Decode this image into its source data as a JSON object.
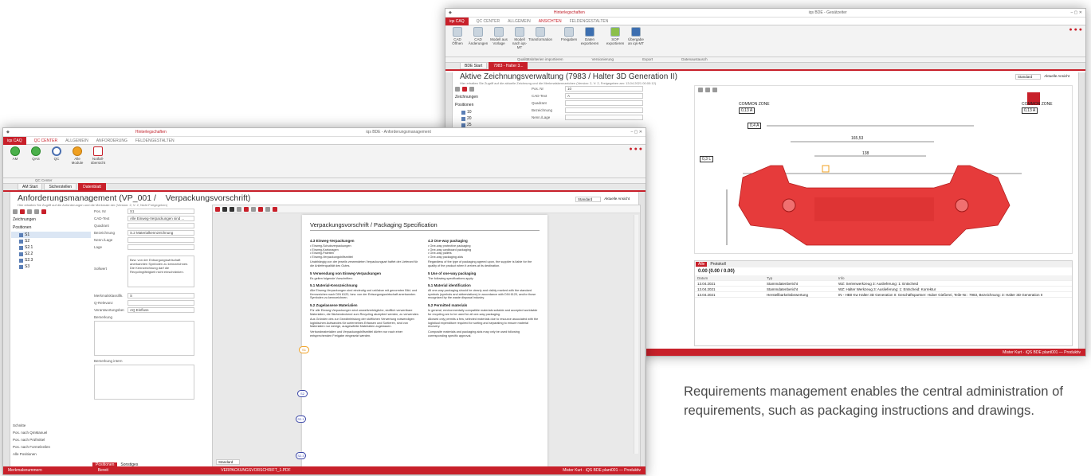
{
  "caption": "Requirements management enables the central administration of requirements, such as packaging instructions and drawings.",
  "back_window": {
    "title": "iqs BDE - Gesätzeiter",
    "context_tab": "Hinterlegschaften",
    "ribbon_tabs": [
      "iqs CAQ",
      "QC CENTER",
      "ALLGEMEIN",
      "ANSICHTEN",
      "FELDENGESTALTEN"
    ],
    "ribbon_buttons": [
      "CAD Öffnen",
      "CAD Änderungen",
      "Modell aus Vorlage",
      "Modell nach iqs-MT",
      "Transformation",
      "Freigaben",
      "Daten exportieren",
      "SOP exportieren",
      "Übergabe an iqs-MT"
    ],
    "ribbon_groups": [
      "Qualitätskriterien importieren",
      "Versionierung",
      "Export",
      "Datenaustausch"
    ],
    "doc_tabs": [
      "BDE Start",
      "7983 - Halter 3..."
    ],
    "heading": "Aktive Zeichnungsverwaltung (7983 / Halter 3D Generation II)",
    "subheading": "Hier erhalten Sie Zugriff auf die aktuelle Zeichnung und die Merkmalskennzeichen (Version: 2, V: 2, Freigegeben am: 13.04.2021 00:00:12)",
    "view_select": "Standard",
    "view_button": "Aktuelle Ansicht",
    "tree_labels": [
      "Zeichnungen",
      "Positionen"
    ],
    "tree_items": [
      "10",
      "20",
      "25"
    ],
    "fields": [
      {
        "label": "Pos. Nr",
        "value": "10"
      },
      {
        "label": "CAD-Text",
        "value": "A"
      },
      {
        "label": "Quadrant",
        "value": ""
      },
      {
        "label": "Bezeichnung",
        "value": ""
      },
      {
        "label": "Nenn./Lage",
        "value": ""
      }
    ],
    "dimensions": [
      "COMMON ZONE",
      "0,13 A",
      "COMMON ZONE",
      "0,13 A",
      "0,4 A",
      "165,53",
      "138",
      "0,3 L"
    ],
    "subpanel_tabs": [
      "Alle",
      "Protokoll"
    ],
    "subpanel_value": "0.00 (0.00 / 0.00)",
    "grid_headers": [
      "Datum",
      "Typ",
      "Info"
    ],
    "grid_rows": [
      [
        "13.04.2021",
        "Stammdatenbericht",
        "WZ: Serienwerkzeug 3: Auslieferung: 1: Entscheid"
      ],
      [
        "13.04.2021",
        "Stammdatenbericht",
        "WZ: Halter Werkzeug 3: Auslieferung: 1: Entscheid: Korrektur"
      ],
      [
        "13.04.2021",
        "Herstellbarkeitsbewertung",
        "IN - HB0 Kw Halter 3D Generation II: Geschäftspartner: Huber Gießerei, Teile-Nr.: 7983, Bezeichnung: 3: Halter 3D Generation II"
      ]
    ],
    "status_user": "Mister Kurt",
    "status_right": "iQS BDE plant001 — Produktiv"
  },
  "front_window": {
    "title": "iqs BDE - Anforderungsmanagement",
    "context_tab": "Hinterlegschaften",
    "ribbon_tabs": [
      "iqs CAQ",
      "QC CENTER",
      "ALLGEMEIN",
      "ANFORDERUNG",
      "FELDENGESTALTEN"
    ],
    "ribbon_buttons": [
      "AM",
      "QAS",
      "QC",
      "Alle Module",
      "Notfall-übersicht"
    ],
    "ribbon_group": "QC Center",
    "doc_tabs": [
      "AM Start",
      "Sicherstellen",
      "Datenblatt"
    ],
    "heading": "Anforderungsmanagement (VP_001 /    Verpackungsvorschrift)",
    "subheading": "Hier erhalten Sie Zugriff auf die Anforderungen und die Merkmale der (Version: 2, V: 2, Nicht Freigegeben)",
    "view_select": "Standard",
    "view_button": "Aktuelle Ansicht",
    "tree_labels": [
      "Zeichnungen",
      "Positionen"
    ],
    "tree_items": [
      "S1",
      "S2",
      "S2.1",
      "S2.2",
      "S2.3",
      "S3"
    ],
    "fields": [
      {
        "label": "Pos. Nr",
        "value": "S1"
      },
      {
        "label": "CAD-Text",
        "value": "Alle Einweg-Verpackungen sind ..."
      },
      {
        "label": "Quadrant",
        "value": ""
      },
      {
        "label": "Bezeichnung",
        "value": "S.2 Materialkennzeichnung"
      },
      {
        "label": "Nenn./Lage",
        "value": ""
      },
      {
        "label": "Lage",
        "value": ""
      }
    ],
    "text_label": "Sollwert",
    "text_value": "Bzw. von der Entsorgungswirtschaft anerkannten Symbolen zu kennzeichnen. Die Kennzeichnung darf die Recyclingfähigkeit nicht einschränken.",
    "fields2": [
      {
        "label": "Merkmalsklassifik.",
        "value": "S"
      },
      {
        "label": "Q-Relevanz",
        "value": ""
      },
      {
        "label": "Verantwortungsber.",
        "value": "AQ Einfluss"
      }
    ],
    "remark_labels": [
      "Bemerkung",
      "Bemerkung intern"
    ],
    "left_bottom_links": [
      "Schnitte",
      "Pos. nach QmManuel",
      "Pos. nach Prüfmittel",
      "Pos. nach Formelzeilen",
      "Alle Positionen"
    ],
    "bottom_tabs": [
      "Positionen",
      "Sonstiges"
    ],
    "doc_file": "VERPACKUNGSVORSCHRIFT_1.PDF",
    "zoom_select": "Standard",
    "page_title": "Verpackungsvorschrift / Packaging Specification",
    "sections_left": [
      {
        "h": "4.3 Einweg-Verpackungen",
        "t": "• Einweg-Schutzverpackungen\n• Einweg-Kartonagen\n• Einweg-Paletten\n• Einweg-Verpackungshilfsmittel"
      },
      {
        "h": "",
        "t": "Unabhängig von der jeweils verwendeten Verpackungsart haftet der Lieferant für die Anlieferqualität des Gutes."
      },
      {
        "h": "5 Verwendung von Einweg-Verpackungen",
        "t": "Es gelten folgende Vorschriften:"
      },
      {
        "h": "5.1 Material-Kennzeichnung",
        "t": "Alle Einweg-Verpackungen sind eindeutig und unlösbar mit genormten Bild- und Kennzeichen nach DIN 6120, bzw. von der Entsorgungswirtschaft anerkannten Symbolen zu kennzeichnen."
      },
      {
        "h": "5.2 Zugelassene Materialien",
        "t": "Für alle Einweg-Verpackungen sind umweltverträgliche, stofflich verwertbare Materialien, die flächendeckend zum Recycling akzeptiert werden, zu verwenden."
      },
      {
        "h": "",
        "t": "Aus Gründen des zur Gewährleistung der stofflichen Verwertung notwendigen logistischen Aufwandes für sortenreines Erfassen und Sortieren, sind von Materialien nur wenige, ausgewählte Materialien zugelassen."
      },
      {
        "h": "",
        "t": "Verbundmaterialien und Verpackungshilfsmittel dürfen nur nach einer entsprechenden Freigabe eingesetzt werden."
      }
    ],
    "sections_right": [
      {
        "h": "4.3 One-way packaging",
        "t": "• One-way protective packaging\n• One-way cardboard packaging\n• One-way pallets\n• One-way packaging aids"
      },
      {
        "h": "",
        "t": "Regardless of the type of packaging agreed upon, the supplier is liable for the quality of the product when it arrives at its destination."
      },
      {
        "h": "5 Use of one-way packaging",
        "t": "The following specifications apply:"
      },
      {
        "h": "5.1 Material identification",
        "t": "All one-way packaging should be clearly and visibly marked with the standard symbols (symbols and abbreviations) in accordance with DIN 6120, and/or those recognized by the waste disposal industry."
      },
      {
        "h": "5.2 Permitted materials",
        "t": "In general, environmentally compatible materials suitable and accepted worldwide for recycling are to be used for all one-way packaging."
      },
      {
        "h": "",
        "t": "Allowed only permits a few, selected materials due to resource associated with the logistical expenditure required for sorting and separating to ensure material recovery."
      },
      {
        "h": "",
        "t": "Composite materials and packaging aids may only be used following corresponding specific approval."
      }
    ],
    "badges": [
      "S1",
      "S2",
      "S2.1",
      "S2.3"
    ],
    "status_user": "Mister Kurt",
    "status_right": "iQS BDE plant001 — Produktiv",
    "status_left": "Bereit",
    "status_tab": "Merkmalsnummern"
  },
  "colors": {
    "accent": "#c8202a",
    "part": "#e63b3b",
    "badge": "#3a46a8"
  }
}
